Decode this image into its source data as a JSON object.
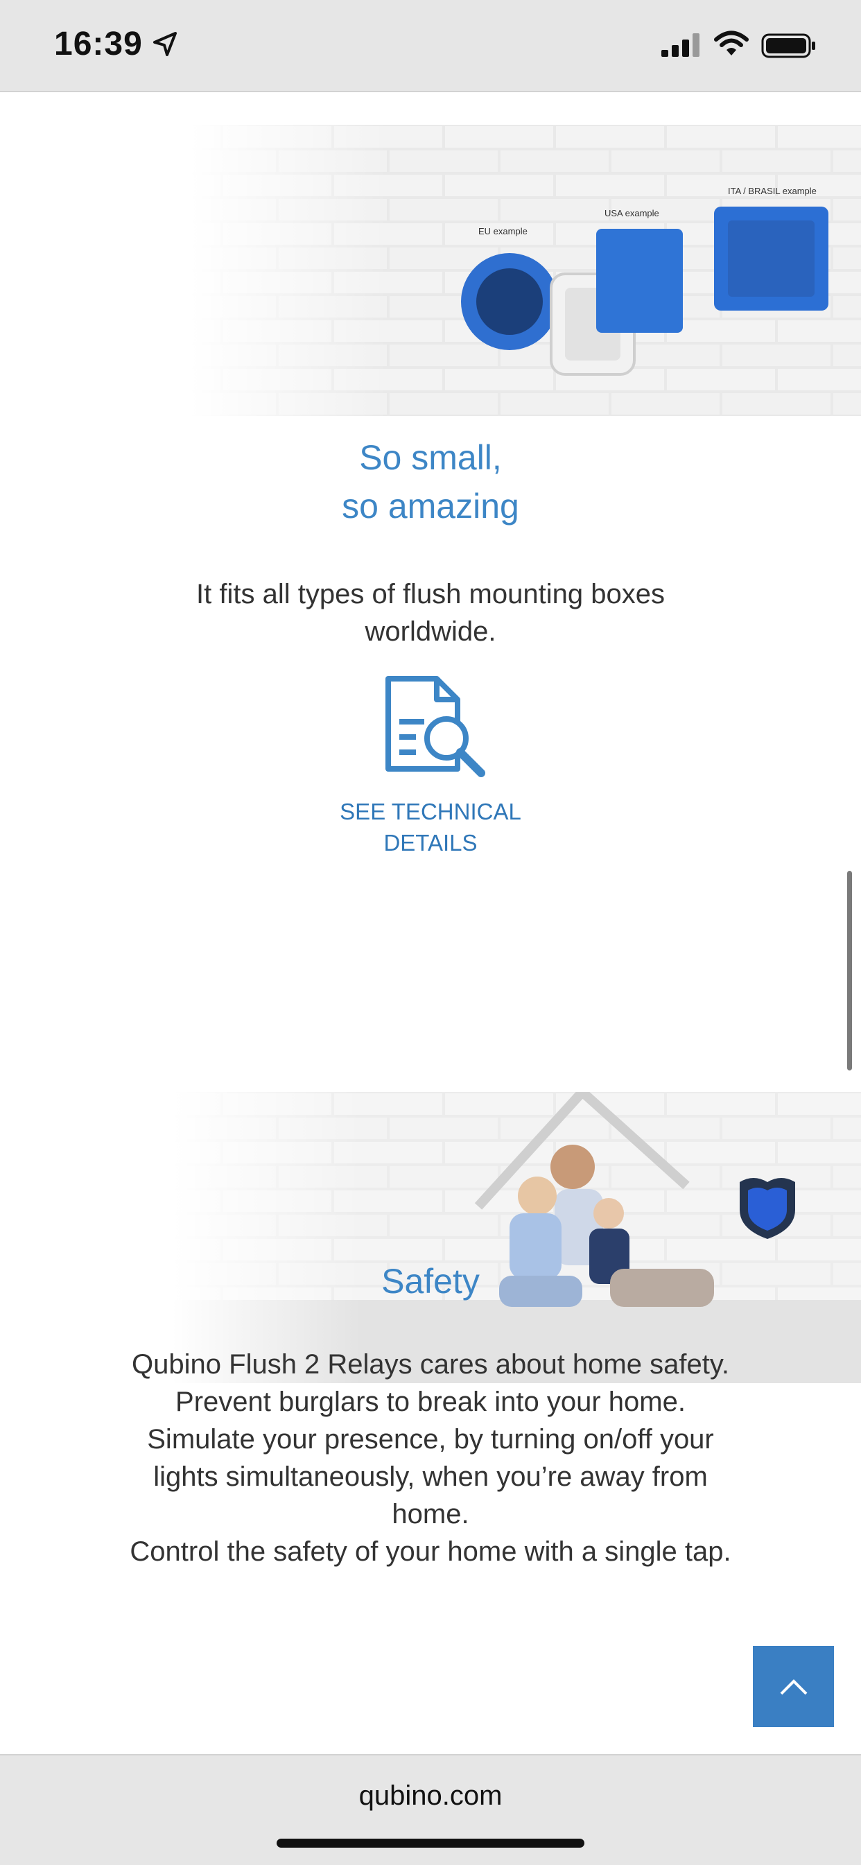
{
  "status": {
    "time": "16:39"
  },
  "hero1": {
    "labels": {
      "eu": "EU example",
      "usa": "USA example",
      "ita": "ITA / BRASIL example"
    }
  },
  "section1": {
    "title_line1": "So small,",
    "title_line2": "so amazing",
    "text_line1": "It fits all types of flush mounting boxes",
    "text_line2": "worldwide.",
    "link_line1": "SEE TECHNICAL",
    "link_line2": "DETAILS"
  },
  "section2": {
    "title": "Safety",
    "lines": [
      "Qubino Flush 2 Relays cares about home safety.",
      "Prevent burglars to break into your home.",
      "Simulate your presence, by turning on/off your",
      "lights simultaneously, when you’re away from",
      "home.",
      "Control the safety of your home with a single tap."
    ]
  },
  "browser": {
    "url": "qubino.com"
  },
  "colors": {
    "accent": "#3d86c6",
    "bar": "#e6e6e6"
  },
  "icons": [
    "location-arrow-icon",
    "cellular-signal-icon",
    "wifi-icon",
    "battery-icon",
    "document-search-icon",
    "chevron-up-icon",
    "shield-icon"
  ]
}
